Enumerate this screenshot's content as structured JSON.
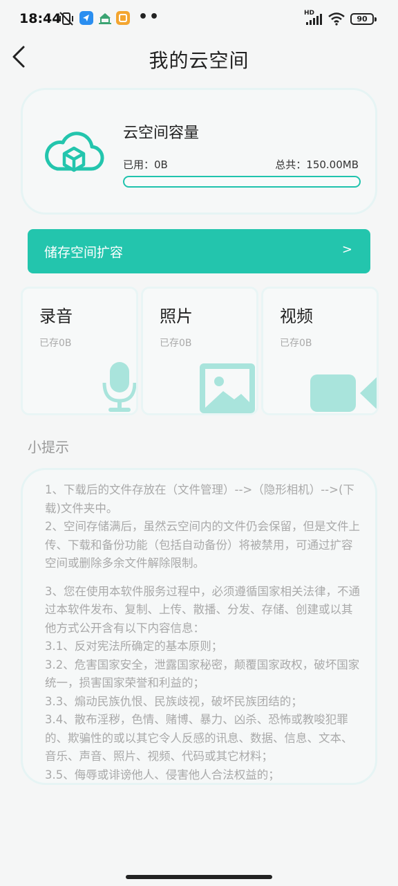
{
  "status_bar": {
    "time": "18:44",
    "network_label": "HD",
    "battery": "90",
    "more_dots": "••",
    "icons": [
      "mute-vibrate-icon",
      "blue-app-icon",
      "house-app-icon",
      "orange-app-icon",
      "signal-icon",
      "wifi-icon",
      "battery-icon"
    ],
    "colors": {
      "blue_app": "#2a8ef0",
      "orange_app": "#f3a530",
      "house_app": "#3aa372"
    }
  },
  "header": {
    "title": "我的云空间",
    "back_icon": "chevron-left-icon"
  },
  "capacity": {
    "title": "云空间容量",
    "used_label": "已用：0B",
    "total_label": "总共：150.00MB",
    "used_fraction": 0,
    "icon": "cloud-box-icon"
  },
  "expand": {
    "label": "储存空间扩容",
    "arrow": ">"
  },
  "media": [
    {
      "title": "录音",
      "stored": "已存0B",
      "icon": "microphone-icon"
    },
    {
      "title": "照片",
      "stored": "已存0B",
      "icon": "image-icon"
    },
    {
      "title": "视频",
      "stored": "已存0B",
      "icon": "video-camera-icon"
    }
  ],
  "tips": {
    "heading": "小提示",
    "paragraphs": [
      "1、下载后的文件存放在（文件管理）-->（隐形相机）-->(下载)文件夹中。",
      "2、空间存储满后，虽然云空间内的文件仍会保留，但是文件上传、下载和备份功能（包括自动备份）将被禁用，可通过扩容空间或删除多余文件解除限制。",
      "3、您在使用本软件服务过程中，必须遵循国家相关法律，不通过本软件发布、复制、上传、散播、分发、存储、创建或以其他方式公开含有以下内容信息：",
      "3.1、反对宪法所确定的基本原则；",
      "3.2、危害国家安全，泄露国家秘密，颠覆国家政权，破坏国家统一，损害国家荣誉和利益的；",
      "3.3、煽动民族仇恨、民族歧视，破坏民族团结的；",
      "3.4、散布淫秽，色情、赌博、暴力、凶杀、恐怖或教唆犯罪的、欺骗性的或以其它令人反感的讯息、数据、信息、文本、音乐、声音、照片、视频、代码或其它材料；",
      "3.5、侮辱或诽谤他人、侵害他人合法权益的；"
    ]
  },
  "colors": {
    "accent": "#23c5ad",
    "icon_tint": "#a9e4dc",
    "background": "#f5f6f6"
  }
}
